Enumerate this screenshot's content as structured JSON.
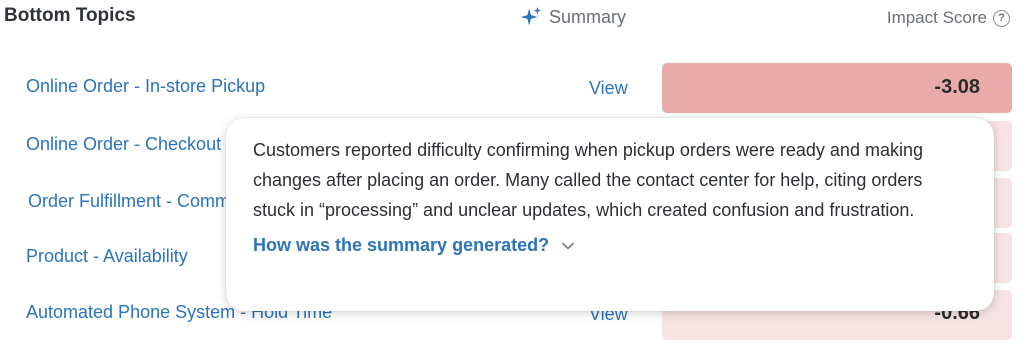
{
  "header": {
    "title": "Bottom Topics",
    "summary_label": "Summary",
    "impact_label": "Impact Score",
    "help_glyph": "?"
  },
  "rows": [
    {
      "topic": "Online Order - In-store Pickup",
      "view": "View",
      "score": "-3.08",
      "intensity": "strong"
    },
    {
      "topic": "Online Order - Checkout",
      "view": "",
      "score": "",
      "intensity": "light"
    },
    {
      "topic": "Order Fulfillment - Communication",
      "view": "",
      "score": "",
      "intensity": "light"
    },
    {
      "topic": "Product - Availability",
      "view": "",
      "score": "",
      "intensity": "light"
    },
    {
      "topic": "Automated Phone System - Hold Time",
      "view": "View",
      "score": "-0.66",
      "intensity": "light"
    }
  ],
  "popover": {
    "text": "Customers reported difficulty confirming when pickup orders were ready and making changes after placing an order. Many called the contact center for help, citing orders stuck in “processing” and unclear updates, which created confusion and frustration.",
    "link": "How was the summary generated?"
  },
  "colors": {
    "link": "#2c73b8",
    "bar_strong": "#e9aaaa",
    "bar_light": "#f7e3e3",
    "sparkle": "#2c73b8"
  }
}
